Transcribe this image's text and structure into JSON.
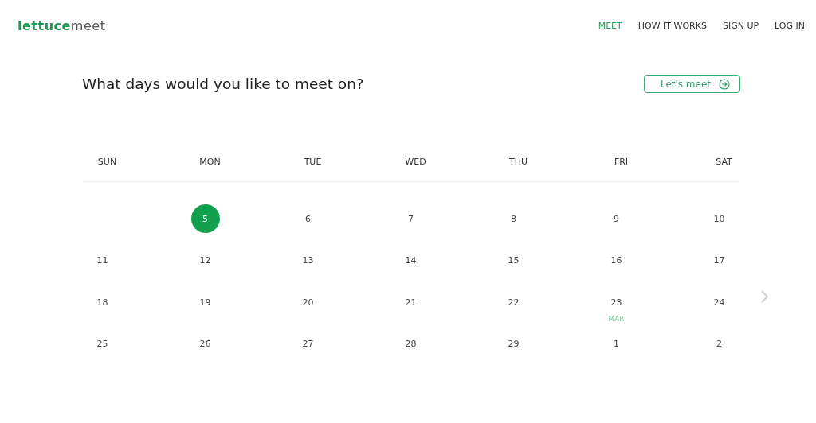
{
  "logo": {
    "bold": "lettuce",
    "light": "meet"
  },
  "nav": [
    {
      "label": "MEET",
      "selected": true
    },
    {
      "label": "HOW IT WORKS",
      "selected": false
    },
    {
      "label": "SIGN UP",
      "selected": false
    },
    {
      "label": "LOG IN",
      "selected": false
    }
  ],
  "heading": "What days would you like to meet on?",
  "action_button": "Let's meet",
  "weekdays": [
    "SUN",
    "MON",
    "TUE",
    "WED",
    "THU",
    "FRI",
    "SAT"
  ],
  "weeks": [
    [
      {
        "kind": "empty"
      },
      {
        "kind": "day",
        "label": "5",
        "selected": true
      },
      {
        "kind": "day",
        "label": "6",
        "selected": false
      },
      {
        "kind": "day",
        "label": "7",
        "selected": false
      },
      {
        "kind": "day",
        "label": "8",
        "selected": false
      },
      {
        "kind": "day",
        "label": "9",
        "selected": false
      },
      {
        "kind": "day",
        "label": "10",
        "selected": false
      }
    ],
    [
      {
        "kind": "day",
        "label": "11",
        "selected": false
      },
      {
        "kind": "day",
        "label": "12",
        "selected": false
      },
      {
        "kind": "day",
        "label": "13",
        "selected": false
      },
      {
        "kind": "day",
        "label": "14",
        "selected": false
      },
      {
        "kind": "day",
        "label": "15",
        "selected": false
      },
      {
        "kind": "day",
        "label": "16",
        "selected": false
      },
      {
        "kind": "day",
        "label": "17",
        "selected": false
      }
    ],
    [
      {
        "kind": "day",
        "label": "18",
        "selected": false
      },
      {
        "kind": "day",
        "label": "19",
        "selected": false
      },
      {
        "kind": "day",
        "label": "20",
        "selected": false
      },
      {
        "kind": "day",
        "label": "21",
        "selected": false
      },
      {
        "kind": "day",
        "label": "22",
        "selected": false
      },
      {
        "kind": "day",
        "label": "23",
        "selected": false
      },
      {
        "kind": "day",
        "label": "24",
        "selected": false
      }
    ],
    [
      {
        "kind": "day",
        "label": "25",
        "selected": false
      },
      {
        "kind": "day",
        "label": "26",
        "selected": false
      },
      {
        "kind": "day",
        "label": "27",
        "selected": false
      },
      {
        "kind": "day",
        "label": "28",
        "selected": false
      },
      {
        "kind": "day",
        "label": "29",
        "selected": false
      },
      {
        "kind": "day",
        "label": "1",
        "selected": false,
        "month": "MAR"
      },
      {
        "kind": "day",
        "label": "2",
        "selected": false
      }
    ]
  ]
}
